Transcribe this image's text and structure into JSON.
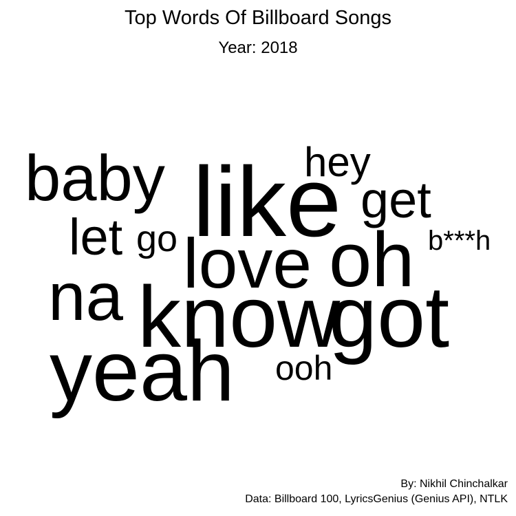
{
  "title": "Top Words Of Billboard Songs",
  "subtitle": "Year: 2018",
  "credits": {
    "author": "By: Nikhil Chinchalkar",
    "source": "Data: Billboard 100, LyricsGenius (Genius API), NTLK"
  },
  "text_color": "#000000",
  "background_color": "#ffffff",
  "words": [
    "baby",
    "like",
    "hey",
    "get",
    "let",
    "go",
    "b***h",
    "love",
    "oh",
    "na",
    "know",
    "got",
    "yeah",
    "ooh"
  ]
}
